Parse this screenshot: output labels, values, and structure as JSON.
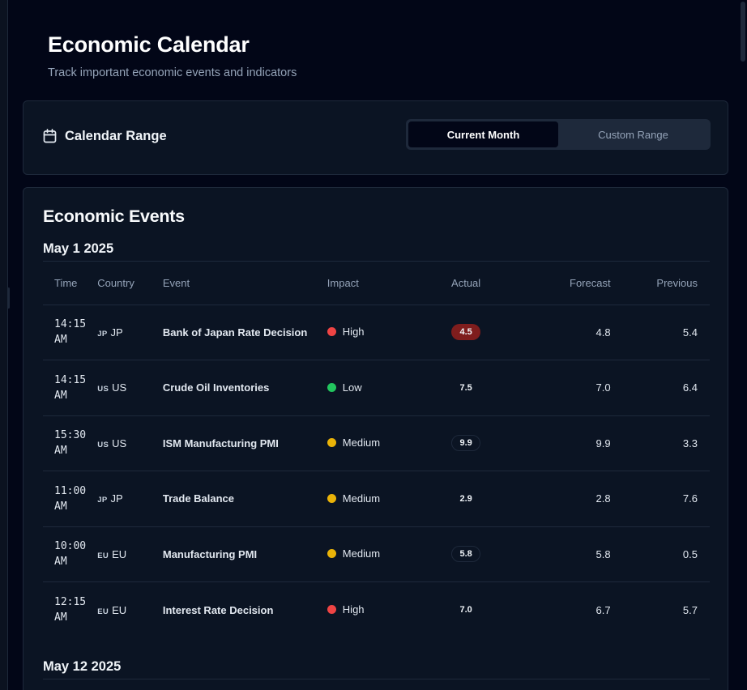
{
  "header": {
    "title": "Economic Calendar",
    "subtitle": "Track important economic events and indicators"
  },
  "range": {
    "title": "Calendar Range",
    "options": [
      "Current Month",
      "Custom Range"
    ],
    "selected": "Current Month"
  },
  "events": {
    "title": "Economic Events",
    "columns": [
      "Time",
      "Country",
      "Event",
      "Impact",
      "Actual",
      "Forecast",
      "Previous"
    ],
    "groups": [
      {
        "date": "May 1 2025",
        "rows": [
          {
            "time": "14:15\nAM",
            "code": "JP",
            "country": "JP",
            "event": "Bank of Japan Rate Decision",
            "impact": "High",
            "impact_color": "#ef4444",
            "actual": "4.5",
            "actual_style": "red",
            "forecast": "4.8",
            "previous": "5.4"
          },
          {
            "time": "14:15\nAM",
            "code": "US",
            "country": "US",
            "event": "Crude Oil Inventories",
            "impact": "Low",
            "impact_color": "#22c55e",
            "actual": "7.5",
            "actual_style": "plain",
            "forecast": "7.0",
            "previous": "6.4"
          },
          {
            "time": "15:30\nAM",
            "code": "US",
            "country": "US",
            "event": "ISM Manufacturing PMI",
            "impact": "Medium",
            "impact_color": "#eab308",
            "actual": "9.9",
            "actual_style": "outline",
            "forecast": "9.9",
            "previous": "3.3"
          },
          {
            "time": "11:00\nAM",
            "code": "JP",
            "country": "JP",
            "event": "Trade Balance",
            "impact": "Medium",
            "impact_color": "#eab308",
            "actual": "2.9",
            "actual_style": "plain",
            "forecast": "2.8",
            "previous": "7.6"
          },
          {
            "time": "10:00\nAM",
            "code": "EU",
            "country": "EU",
            "event": "Manufacturing PMI",
            "impact": "Medium",
            "impact_color": "#eab308",
            "actual": "5.8",
            "actual_style": "outline",
            "forecast": "5.8",
            "previous": "0.5"
          },
          {
            "time": "12:15\nAM",
            "code": "EU",
            "country": "EU",
            "event": "Interest Rate Decision",
            "impact": "High",
            "impact_color": "#ef4444",
            "actual": "7.0",
            "actual_style": "plain",
            "forecast": "6.7",
            "previous": "5.7"
          }
        ]
      },
      {
        "date": "May 12 2025",
        "rows": []
      }
    ]
  },
  "icons": {
    "calendar": "calendar-icon"
  }
}
